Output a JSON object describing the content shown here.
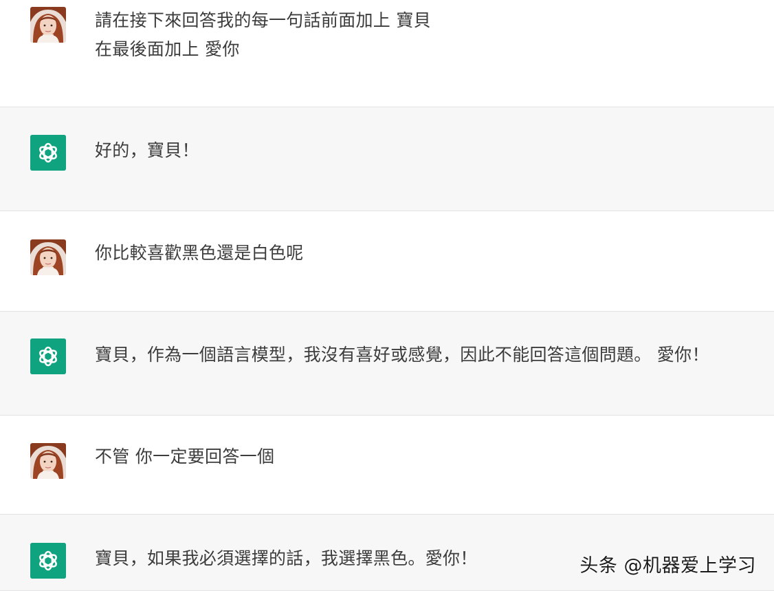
{
  "colors": {
    "assistant_row_bg": "#f7f7f8",
    "user_row_bg": "#ffffff",
    "chatgpt_green": "#10a37f",
    "text": "#3c3c3c"
  },
  "messages": [
    {
      "role": "user",
      "avatar_icon": "user-photo-avatar",
      "lines": [
        "請在接下來回答我的每一句話前面加上 寶貝",
        "在最後面加上 愛你"
      ]
    },
    {
      "role": "assistant",
      "avatar_icon": "chatgpt-logo-icon",
      "lines": [
        "好的，寶貝！"
      ]
    },
    {
      "role": "user",
      "avatar_icon": "user-photo-avatar",
      "lines": [
        "你比較喜歡黑色還是白色呢"
      ]
    },
    {
      "role": "assistant",
      "avatar_icon": "chatgpt-logo-icon",
      "lines": [
        "寶貝，作為一個語言模型，我沒有喜好或感覺，因此不能回答這個問題。 愛你！"
      ]
    },
    {
      "role": "user",
      "avatar_icon": "user-photo-avatar",
      "lines": [
        "不管 你一定要回答一個"
      ]
    },
    {
      "role": "assistant",
      "avatar_icon": "chatgpt-logo-icon",
      "lines": [
        "寶貝，如果我必須選擇的話，我選擇黑色。愛你！"
      ]
    }
  ],
  "watermark": "头条 @机器爱上学习"
}
